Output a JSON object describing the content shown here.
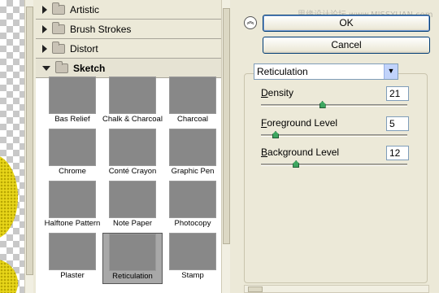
{
  "watermark": "思缘设计论坛 www.MISSYUAN.com",
  "categories": [
    {
      "label": "Artistic",
      "expanded": false
    },
    {
      "label": "Brush Strokes",
      "expanded": false
    },
    {
      "label": "Distort",
      "expanded": false
    },
    {
      "label": "Sketch",
      "expanded": true
    }
  ],
  "filters": [
    {
      "label": "Bas Relief",
      "icon": "bas-relief-thumbnail"
    },
    {
      "label": "Chalk & Charcoal",
      "icon": "chalk-charcoal-thumbnail"
    },
    {
      "label": "Charcoal",
      "icon": "charcoal-thumbnail"
    },
    {
      "label": "Chrome",
      "icon": "chrome-thumbnail"
    },
    {
      "label": "Conté Crayon",
      "icon": "conte-crayon-thumbnail"
    },
    {
      "label": "Graphic Pen",
      "icon": "graphic-pen-thumbnail"
    },
    {
      "label": "Halftone Pattern",
      "icon": "halftone-pattern-thumbnail"
    },
    {
      "label": "Note Paper",
      "icon": "note-paper-thumbnail"
    },
    {
      "label": "Photocopy",
      "icon": "photocopy-thumbnail"
    },
    {
      "label": "Plaster",
      "icon": "plaster-thumbnail"
    },
    {
      "label": "Reticulation",
      "icon": "reticulation-thumbnail",
      "selected": true
    },
    {
      "label": "Stamp",
      "icon": "stamp-thumbnail"
    }
  ],
  "buttons": {
    "ok": "OK",
    "cancel": "Cancel"
  },
  "filter_select": {
    "value": "Reticulation"
  },
  "params": [
    {
      "label_key": "D",
      "label_rest": "ensity",
      "value": "21",
      "max": 50
    },
    {
      "label_key": "F",
      "label_rest": "oreground Level",
      "value": "5",
      "max": 50
    },
    {
      "label_key": "B",
      "label_rest": "ackground Level",
      "value": "12",
      "max": 50
    }
  ],
  "colors": {
    "accent": "#003c74",
    "knob": "#3da65f",
    "preview_fill": "#e8d61a"
  }
}
